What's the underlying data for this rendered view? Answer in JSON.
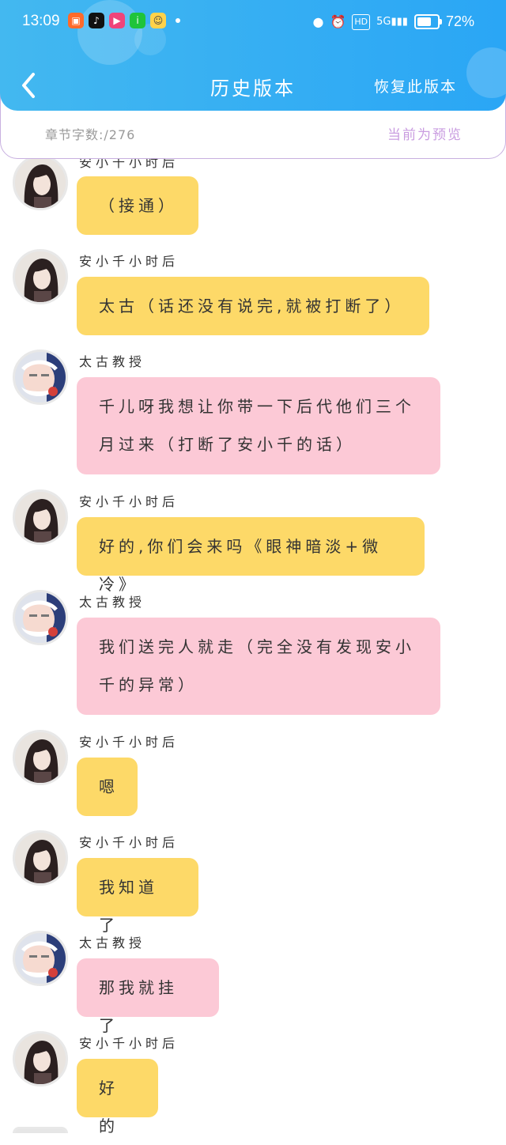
{
  "status_bar": {
    "time": "13:09",
    "battery_percent": "72%",
    "battery_level": 0.72,
    "network": "5G"
  },
  "nav": {
    "title": "历史版本",
    "restore_label": "恢复此版本"
  },
  "info": {
    "word_count": "章节字数:/276",
    "preview_status": "当前为预览"
  },
  "colors": {
    "header": "#35aef3",
    "bubble_an": "#fdd968",
    "bubble_taigu": "#fcc9d6",
    "preview_text": "#c99ce0"
  },
  "messages": [
    {
      "sender": "安小千小时后",
      "text": "（接通）",
      "color": "yellow"
    },
    {
      "sender": "安小千小时后",
      "text": "太古（话还没有说完,就被打断了）",
      "color": "yellow"
    },
    {
      "sender": "太古教授",
      "text": "千儿呀我想让你带一下后代他们三个月过来（打断了安小千的话）",
      "color": "pink"
    },
    {
      "sender": "安小千小时后",
      "text": "好的,你们会来吗《眼神暗淡+微冷》",
      "color": "yellow"
    },
    {
      "sender": "太古教授",
      "text": "我们送完人就走（完全没有发现安小千的异常）",
      "color": "pink"
    },
    {
      "sender": "安小千小时后",
      "text": "嗯",
      "color": "yellow"
    },
    {
      "sender": "安小千小时后",
      "text": "我知道了",
      "color": "yellow"
    },
    {
      "sender": "太古教授",
      "text": "那我就挂了",
      "color": "pink"
    },
    {
      "sender": "安小千小时后",
      "text": "好的",
      "color": "yellow"
    }
  ]
}
